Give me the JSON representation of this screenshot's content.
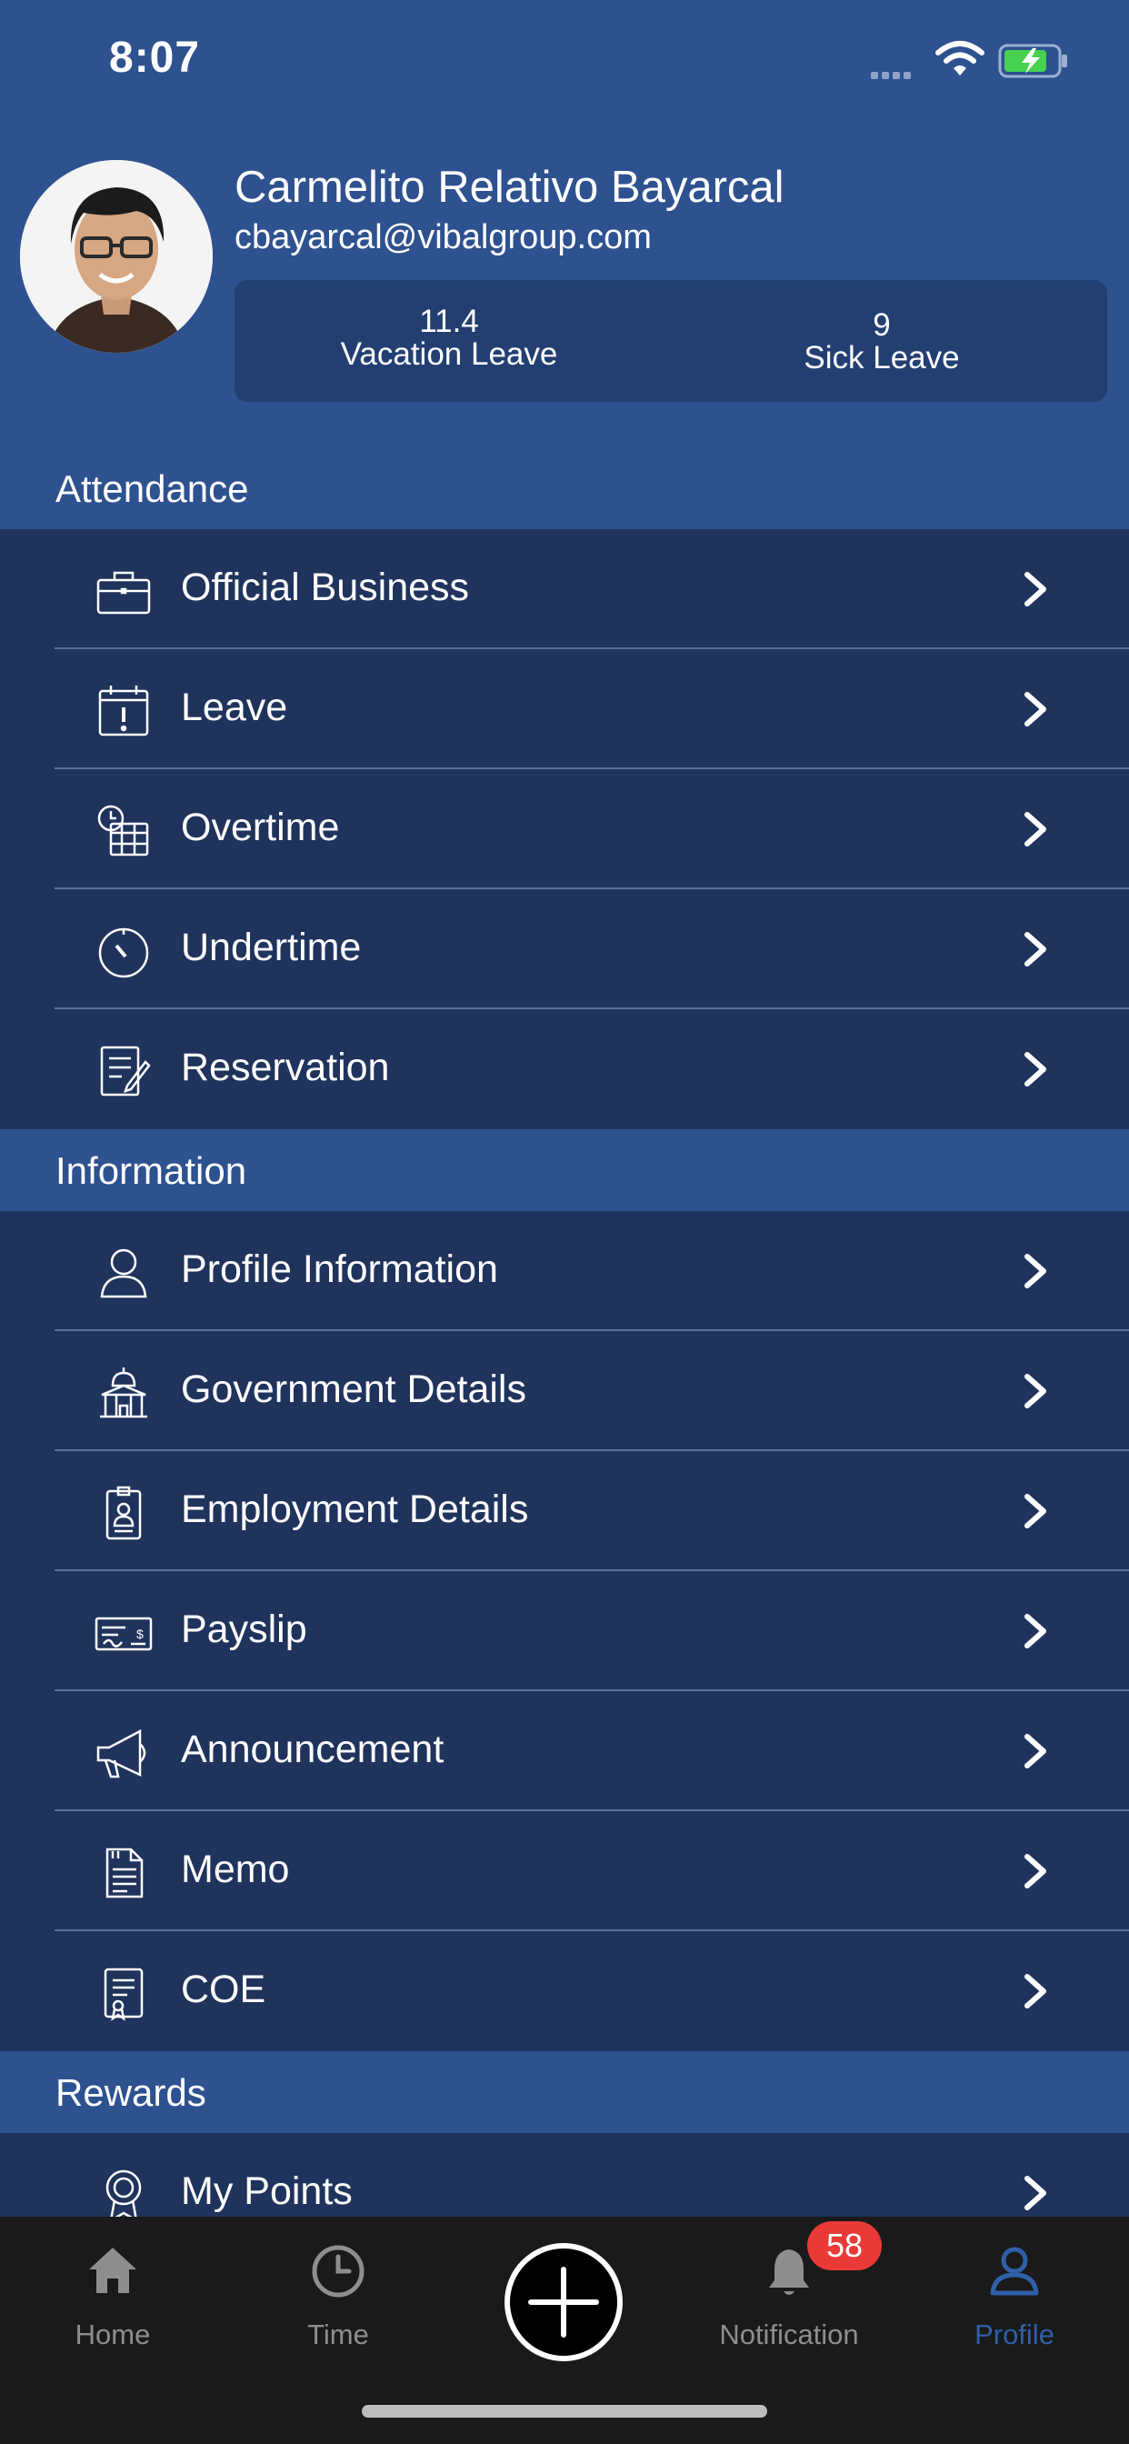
{
  "status": {
    "time": "8:07"
  },
  "profile": {
    "name": "Carmelito Relativo Bayarcal",
    "email": "cbayarcal@vibalgroup.com",
    "vacation_value": "11.4",
    "vacation_label": "Vacation Leave",
    "sick_value": "9",
    "sick_label": "Sick Leave"
  },
  "sections": {
    "attendance": {
      "title": "Attendance",
      "items": [
        {
          "label": "Official Business",
          "icon": "briefcase-icon"
        },
        {
          "label": "Leave",
          "icon": "calendar-alert-icon"
        },
        {
          "label": "Overtime",
          "icon": "clock-calendar-icon"
        },
        {
          "label": "Undertime",
          "icon": "timer-icon"
        },
        {
          "label": "Reservation",
          "icon": "document-pen-icon"
        }
      ]
    },
    "information": {
      "title": "Information",
      "items": [
        {
          "label": "Profile Information",
          "icon": "person-icon"
        },
        {
          "label": "Government Details",
          "icon": "government-building-icon"
        },
        {
          "label": "Employment Details",
          "icon": "id-badge-icon"
        },
        {
          "label": "Payslip",
          "icon": "cheque-icon"
        },
        {
          "label": "Announcement",
          "icon": "megaphone-icon"
        },
        {
          "label": "Memo",
          "icon": "memo-document-icon"
        },
        {
          "label": "COE",
          "icon": "certificate-icon"
        }
      ]
    },
    "rewards": {
      "title": "Rewards",
      "items": [
        {
          "label": "My Points",
          "icon": "award-ribbon-icon"
        }
      ]
    }
  },
  "tabs": {
    "home": "Home",
    "time": "Time",
    "notification": "Notification",
    "profile": "Profile",
    "notification_badge": "58"
  },
  "colors": {
    "header_bg": "#2e518f",
    "list_bg": "#1f335c",
    "tab_bar_bg": "#1a1a1a",
    "active_tab": "#2f5fa8",
    "badge": "#ea3a37"
  }
}
